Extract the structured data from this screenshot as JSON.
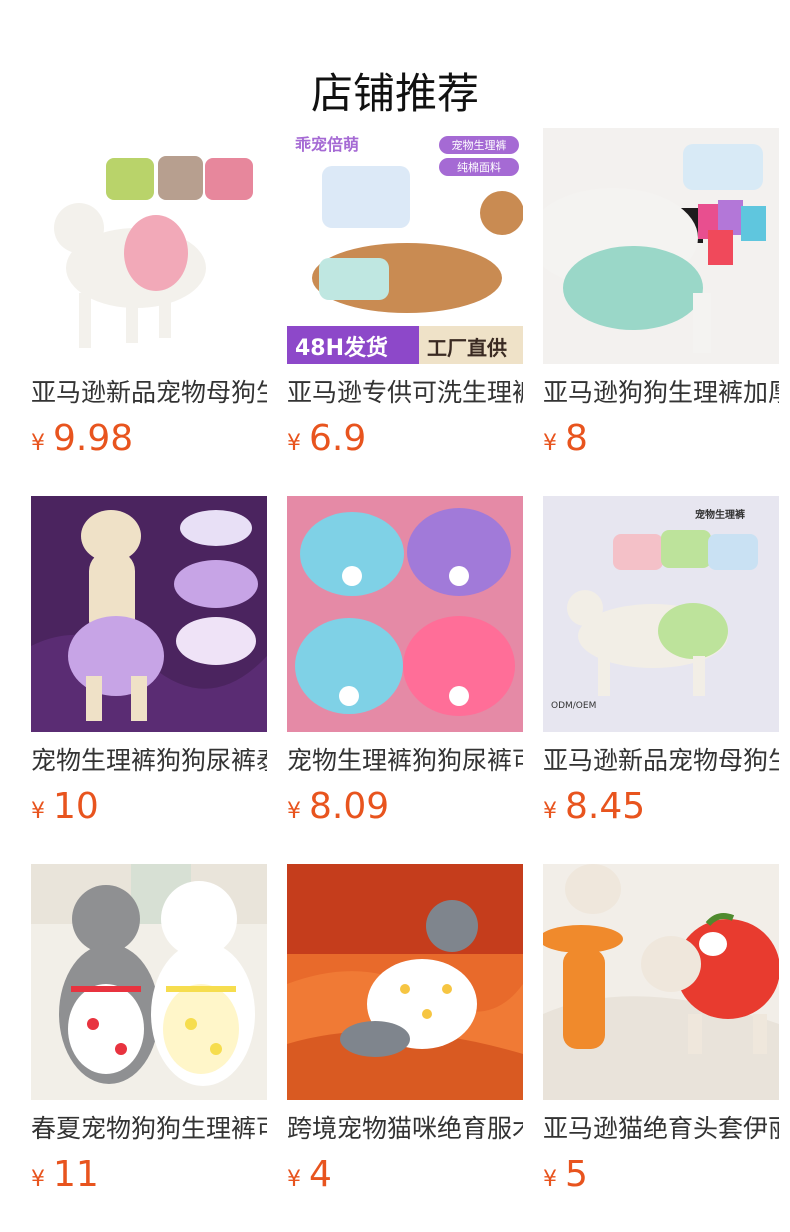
{
  "header": {
    "title": "店铺推荐"
  },
  "theme": {
    "price_color": "#e8541e"
  },
  "products": [
    {
      "name": "亚马逊新品宠物母狗生理裤",
      "currency": "¥",
      "price": "9.98",
      "image": {
        "bg": "#ffffff",
        "accent": "#f2a9b8",
        "secondary": "#b9d36a",
        "subject": "#f3f1ec",
        "subject_kind": "dog",
        "banner": null,
        "badges": []
      }
    },
    {
      "name": "亚马逊专供可洗生理裤宠物",
      "currency": "¥",
      "price": "6.9",
      "image": {
        "bg": "#ffffff",
        "accent": "#a56ad4",
        "secondary": "#e9b27a",
        "subject": "#c98b52",
        "subject_kind": "dog",
        "banner": {
          "left": "48H发货",
          "right": "工厂直供"
        },
        "badges": [
          "宠物生理裤",
          "纯棉面料"
        ],
        "logo_text": "乖宠倍萌"
      }
    },
    {
      "name": "亚马逊狗狗生理裤加厚防漏",
      "currency": "¥",
      "price": "8",
      "image": {
        "bg": "#f3f1ef",
        "accent": "#9ad7c8",
        "secondary": "#e84f8f",
        "subject": "#f4f3f1",
        "subject_kind": "dog",
        "banner": null,
        "badges": []
      }
    },
    {
      "name": "宠物生理裤狗狗尿裤泰迪",
      "currency": "¥",
      "price": "10",
      "image": {
        "bg": "#4b245f",
        "accent": "#c7a4e6",
        "secondary": "#efe3f7",
        "subject": "#efe1c7",
        "subject_kind": "dog",
        "banner": null,
        "badges": []
      }
    },
    {
      "name": "宠物生理裤狗狗尿裤可洗",
      "currency": "¥",
      "price": "8.09",
      "image": {
        "bg": "#e58aa6",
        "accent": "#7fd1e6",
        "secondary": "#a17ad9",
        "subject": "#ff6e98",
        "subject_kind": "product",
        "banner": null,
        "badges": []
      }
    },
    {
      "name": "亚马逊新品宠物母狗生理裤",
      "currency": "¥",
      "price": "8.45",
      "image": {
        "bg": "#e7e6f0",
        "accent": "#bde39b",
        "secondary": "#f4c1c8",
        "subject": "#f2eee6",
        "subject_kind": "dog",
        "banner": null,
        "badges": [],
        "caption_top": "宠物生理裤",
        "caption_bottom": "ODM/OEM"
      }
    },
    {
      "name": "春夏宠物狗狗生理裤可爱",
      "currency": "¥",
      "price": "11",
      "image": {
        "bg": "#f2efe8",
        "accent": "#e8333f",
        "secondary": "#f6dd4e",
        "subject": "#8f9092",
        "subject_kind": "two-dogs",
        "banner": null,
        "badges": []
      }
    },
    {
      "name": "跨境宠物猫咪绝育服术后",
      "currency": "¥",
      "price": "4",
      "image": {
        "bg": "#e86a2b",
        "accent": "#f6c542",
        "secondary": "#ffffff",
        "subject": "#7f858d",
        "subject_kind": "cat",
        "banner": null,
        "badges": []
      }
    },
    {
      "name": "亚马逊猫绝育头套伊丽莎白",
      "currency": "¥",
      "price": "5",
      "image": {
        "bg": "#f2eee8",
        "accent": "#e83b2f",
        "secondary": "#f08a2c",
        "subject": "#efe7dc",
        "subject_kind": "dog-apple",
        "banner": null,
        "badges": []
      }
    }
  ]
}
